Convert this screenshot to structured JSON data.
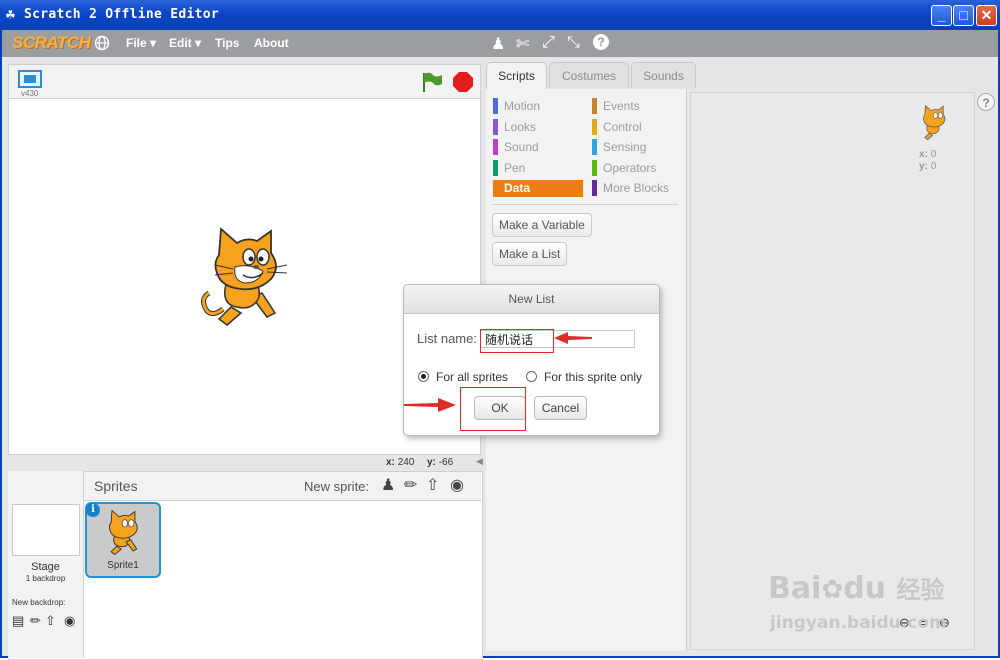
{
  "window": {
    "title": "Scratch 2 Offline Editor",
    "minimize_icon": "minimize-icon",
    "maximize_icon": "maximize-icon",
    "close_icon": "close-icon"
  },
  "menubar": {
    "logo_text": "SCRATCH",
    "globe_icon": "globe-icon",
    "file_label": "File",
    "edit_label": "Edit",
    "tips_label": "Tips",
    "about_label": "About",
    "tools": [
      "duplicate-icon",
      "delete-icon",
      "grow-icon",
      "shrink-icon",
      "help-icon"
    ]
  },
  "stage": {
    "version": "v430",
    "fullscreen_icon": "fullscreen-icon",
    "green_flag_icon": "green-flag-icon",
    "stop_icon": "stop-icon",
    "x_label": "x:",
    "x_value": "240",
    "y_label": "y:",
    "y_value": "-66"
  },
  "tabs": [
    "Scripts",
    "Costumes",
    "Sounds"
  ],
  "categories_left": [
    {
      "label": "Motion",
      "color": "#4a6cd4"
    },
    {
      "label": "Looks",
      "color": "#8a55d7"
    },
    {
      "label": "Sound",
      "color": "#bb42c3"
    },
    {
      "label": "Pen",
      "color": "#0e9a6c"
    },
    {
      "label": "Data",
      "color": "#ee7d16"
    }
  ],
  "categories_right": [
    {
      "label": "Events",
      "color": "#c88330"
    },
    {
      "label": "Control",
      "color": "#e1a91a"
    },
    {
      "label": "Sensing",
      "color": "#2ca5e2"
    },
    {
      "label": "Operators",
      "color": "#5cb712"
    },
    {
      "label": "More Blocks",
      "color": "#632d99"
    }
  ],
  "palette": {
    "make_variable": "Make a Variable",
    "make_list": "Make a List"
  },
  "script_area": {
    "x_label": "x:",
    "x_value": "0",
    "y_label": "y:",
    "y_value": "0",
    "help_icon": "help-icon"
  },
  "dialog": {
    "title": "New List",
    "name_label": "List name:",
    "name_value": "随机说话",
    "option_all": "For all sprites",
    "option_this": "For this sprite only",
    "ok_label": "OK",
    "cancel_label": "Cancel"
  },
  "sprites": {
    "header": "Sprites",
    "new_sprite_label": "New sprite:",
    "stage_label": "Stage",
    "backdrop_count": "1 backdrop",
    "new_backdrop_label": "New backdrop:",
    "sprite_name": "Sprite1",
    "info_icon": "info-icon"
  },
  "watermark": {
    "brand": "Bai",
    "brand2": "du",
    "cn": "经验",
    "url": "jingyan.baidu.com"
  },
  "accent_colors": {
    "titlebar": "#0b46c9",
    "data_category": "#ee7d16",
    "annotation": "#e02b2b"
  }
}
